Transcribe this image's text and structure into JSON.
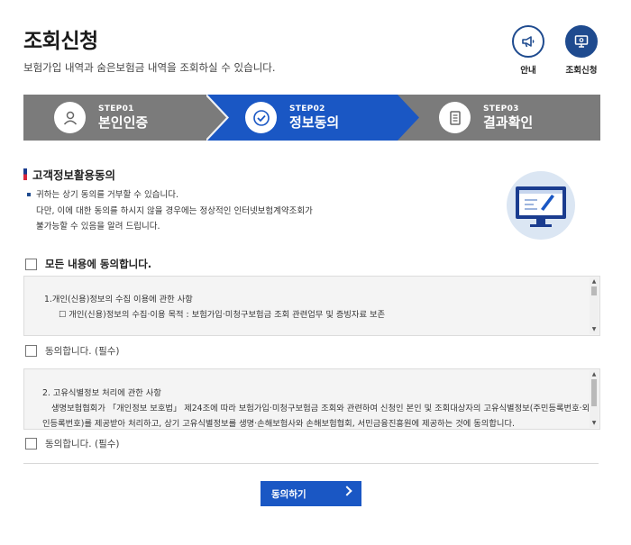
{
  "header": {
    "title": "조회신청",
    "subtitle": "보험가입 내역과 숨은보험금 내역을 조회하실 수 있습니다."
  },
  "top_buttons": [
    {
      "label": "안내",
      "icon": "megaphone-icon"
    },
    {
      "label": "조회신청",
      "icon": "monitor-icon"
    }
  ],
  "steps": [
    {
      "number": "STEP01",
      "title": "본인인증",
      "icon": "person-icon",
      "active": false
    },
    {
      "number": "STEP02",
      "title": "정보동의",
      "icon": "check-circle-icon",
      "active": true
    },
    {
      "number": "STEP03",
      "title": "결과확인",
      "icon": "document-icon",
      "active": false
    }
  ],
  "colors": {
    "step_inactive": "#7b7b7b",
    "step_active": "#1a57c4",
    "primary": "#1f4b8f",
    "button": "#1a57c4"
  },
  "section": {
    "title": "고객정보활용동의",
    "notice_lines": [
      "귀하는 상기 동의를 거부할 수 있습니다.",
      "다만, 이에 대한 동의를 하시지 않을 경우에는 정상적인 인터넷보험계약조회가",
      "불가능할 수 있음을 알려 드립니다."
    ]
  },
  "agree_all": {
    "label": "모든 내용에 동의합니다."
  },
  "terms": [
    {
      "heading": "1.개인(신용)정보의 수집 이용에 관한 사항",
      "body": "☐ 개인(신용)정보의 수집·이용 목적 : 보험가입·미청구보험금 조회 관련업무 및 증빙자료 보존",
      "agree_label": "동의합니다. (필수)"
    },
    {
      "heading": "2. 고유식별정보 처리에 관한 사항",
      "body_line1": "생명보험협회가 「개인정보 보호법」 제24조에 따라 보험가입·미청구보험금 조회와 관련하여 신청인 본인 및 조회대상자의 고유식별정보(주민등록번호·외국",
      "body_line2": "인등록번호)를 제공받아 처리하고, 상기 고유식별정보를 생명·손해보험사와 손해보험협회, 서민금융진흥원에 제공하는 것에 동의합니다.",
      "agree_label": "동의합니다. (필수)"
    }
  ],
  "submit": {
    "label": "동의하기"
  }
}
